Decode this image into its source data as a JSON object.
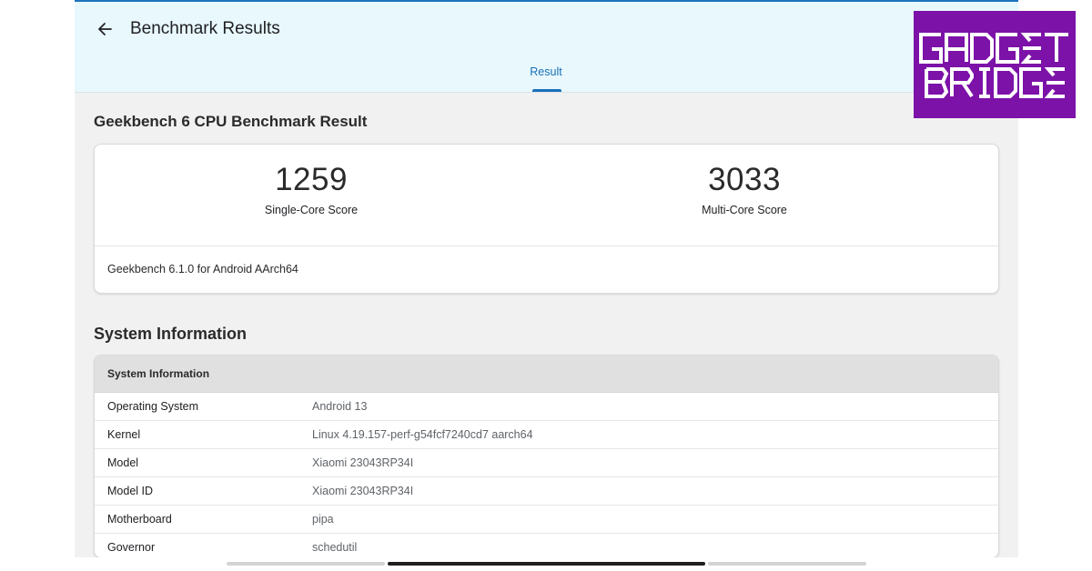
{
  "header": {
    "title": "Benchmark Results",
    "tabs": [
      {
        "label": "Result",
        "active": true
      }
    ]
  },
  "benchmark": {
    "heading": "Geekbench 6 CPU Benchmark Result",
    "single_core": {
      "value": "1259",
      "label": "Single-Core Score"
    },
    "multi_core": {
      "value": "3033",
      "label": "Multi-Core Score"
    },
    "version": "Geekbench 6.1.0 for Android AArch64"
  },
  "system_info": {
    "heading": "System Information",
    "table_header": "System Information",
    "rows": [
      {
        "key": "Operating System",
        "value": "Android 13"
      },
      {
        "key": "Kernel",
        "value": "Linux 4.19.157-perf-g54fcf7240cd7 aarch64"
      },
      {
        "key": "Model",
        "value": "Xiaomi 23043RP34I"
      },
      {
        "key": "Model ID",
        "value": "Xiaomi 23043RP34I"
      },
      {
        "key": "Motherboard",
        "value": "pipa"
      },
      {
        "key": "Governor",
        "value": "schedutil"
      }
    ]
  },
  "watermark": {
    "line1": "GADGET",
    "line2": "BRIDGE"
  },
  "colors": {
    "accent": "#1a6fb8",
    "appbar_bg": "#e8f8fd",
    "watermark_bg": "#7c12a8"
  },
  "icons": {
    "back": "arrow-left-icon"
  }
}
